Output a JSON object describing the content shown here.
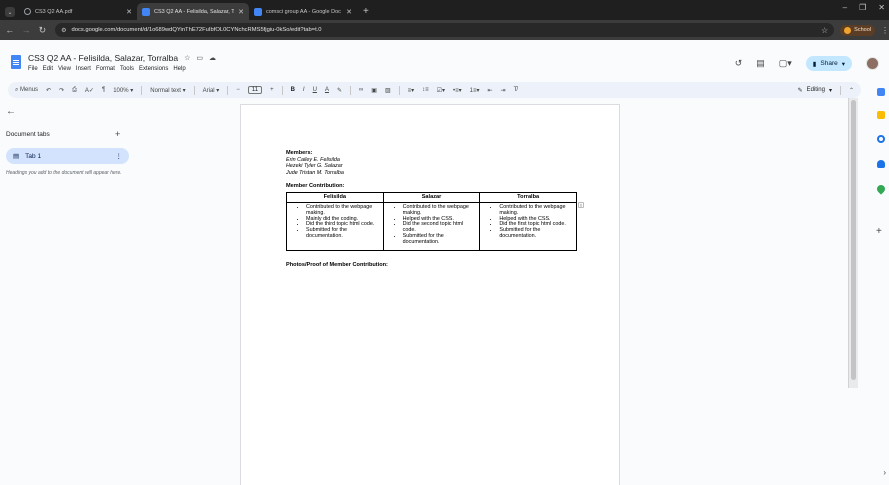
{
  "browser": {
    "tabs": [
      {
        "title": "CS3 Q2 AA.pdf",
        "icon_color": "#9aa0a6",
        "active": false
      },
      {
        "title": "CS3 Q2 AA - Felisilda, Salazar, T",
        "icon_color": "#4285f4",
        "active": true
      },
      {
        "title": "comsci group AA - Google Doc",
        "icon_color": "#4285f4",
        "active": false
      }
    ],
    "url": "docs.google.com/document/d/1o689wdQYinThE72FuIbfOL0CYNchcRMS5fjgiu-0kSo/edit?tab=t.0",
    "profile_label": "School",
    "window_controls": [
      "–",
      "❐",
      "✕"
    ]
  },
  "doc_header": {
    "title": "CS3 Q2 AA - Felisilda, Salazar, Torralba",
    "menu": [
      "File",
      "Edit",
      "View",
      "Insert",
      "Format",
      "Tools",
      "Extensions",
      "Help"
    ],
    "share_label": "Share"
  },
  "toolbar": {
    "menus_label": "Menus",
    "zoom": "100%",
    "style": "Normal text",
    "font": "Arial",
    "font_size": "11",
    "mode": "Editing"
  },
  "sidebar": {
    "heading": "Document tabs",
    "tab_label": "Tab 1",
    "hint": "Headings you add to the document will appear here."
  },
  "document": {
    "members_heading": "Members:",
    "members": [
      "Erin Cailey E. Felisilda",
      "Hezeki Tyler G. Salazar",
      "Jude Tristan M. Torralba"
    ],
    "contribution_heading": "Member Contribution:",
    "table": {
      "headers": [
        "Felisilda",
        "Salazar",
        "Torralba"
      ],
      "columns": [
        [
          "Contributed to the webpage making.",
          "Mainly did the coding.",
          "Did the third topic html code.",
          "Submitted for the documentation."
        ],
        [
          "Contributed to the webpage making.",
          "Helped with the CSS.",
          "Did the second topic html code.",
          "Submitted for the documentation."
        ],
        [
          "Contributed to the webpage making.",
          "Helped with the CSS.",
          "Did the first topic html code.",
          "Submitted for the documentation."
        ]
      ]
    },
    "proof_heading": "Photos/Proof of Member Contribution:"
  }
}
